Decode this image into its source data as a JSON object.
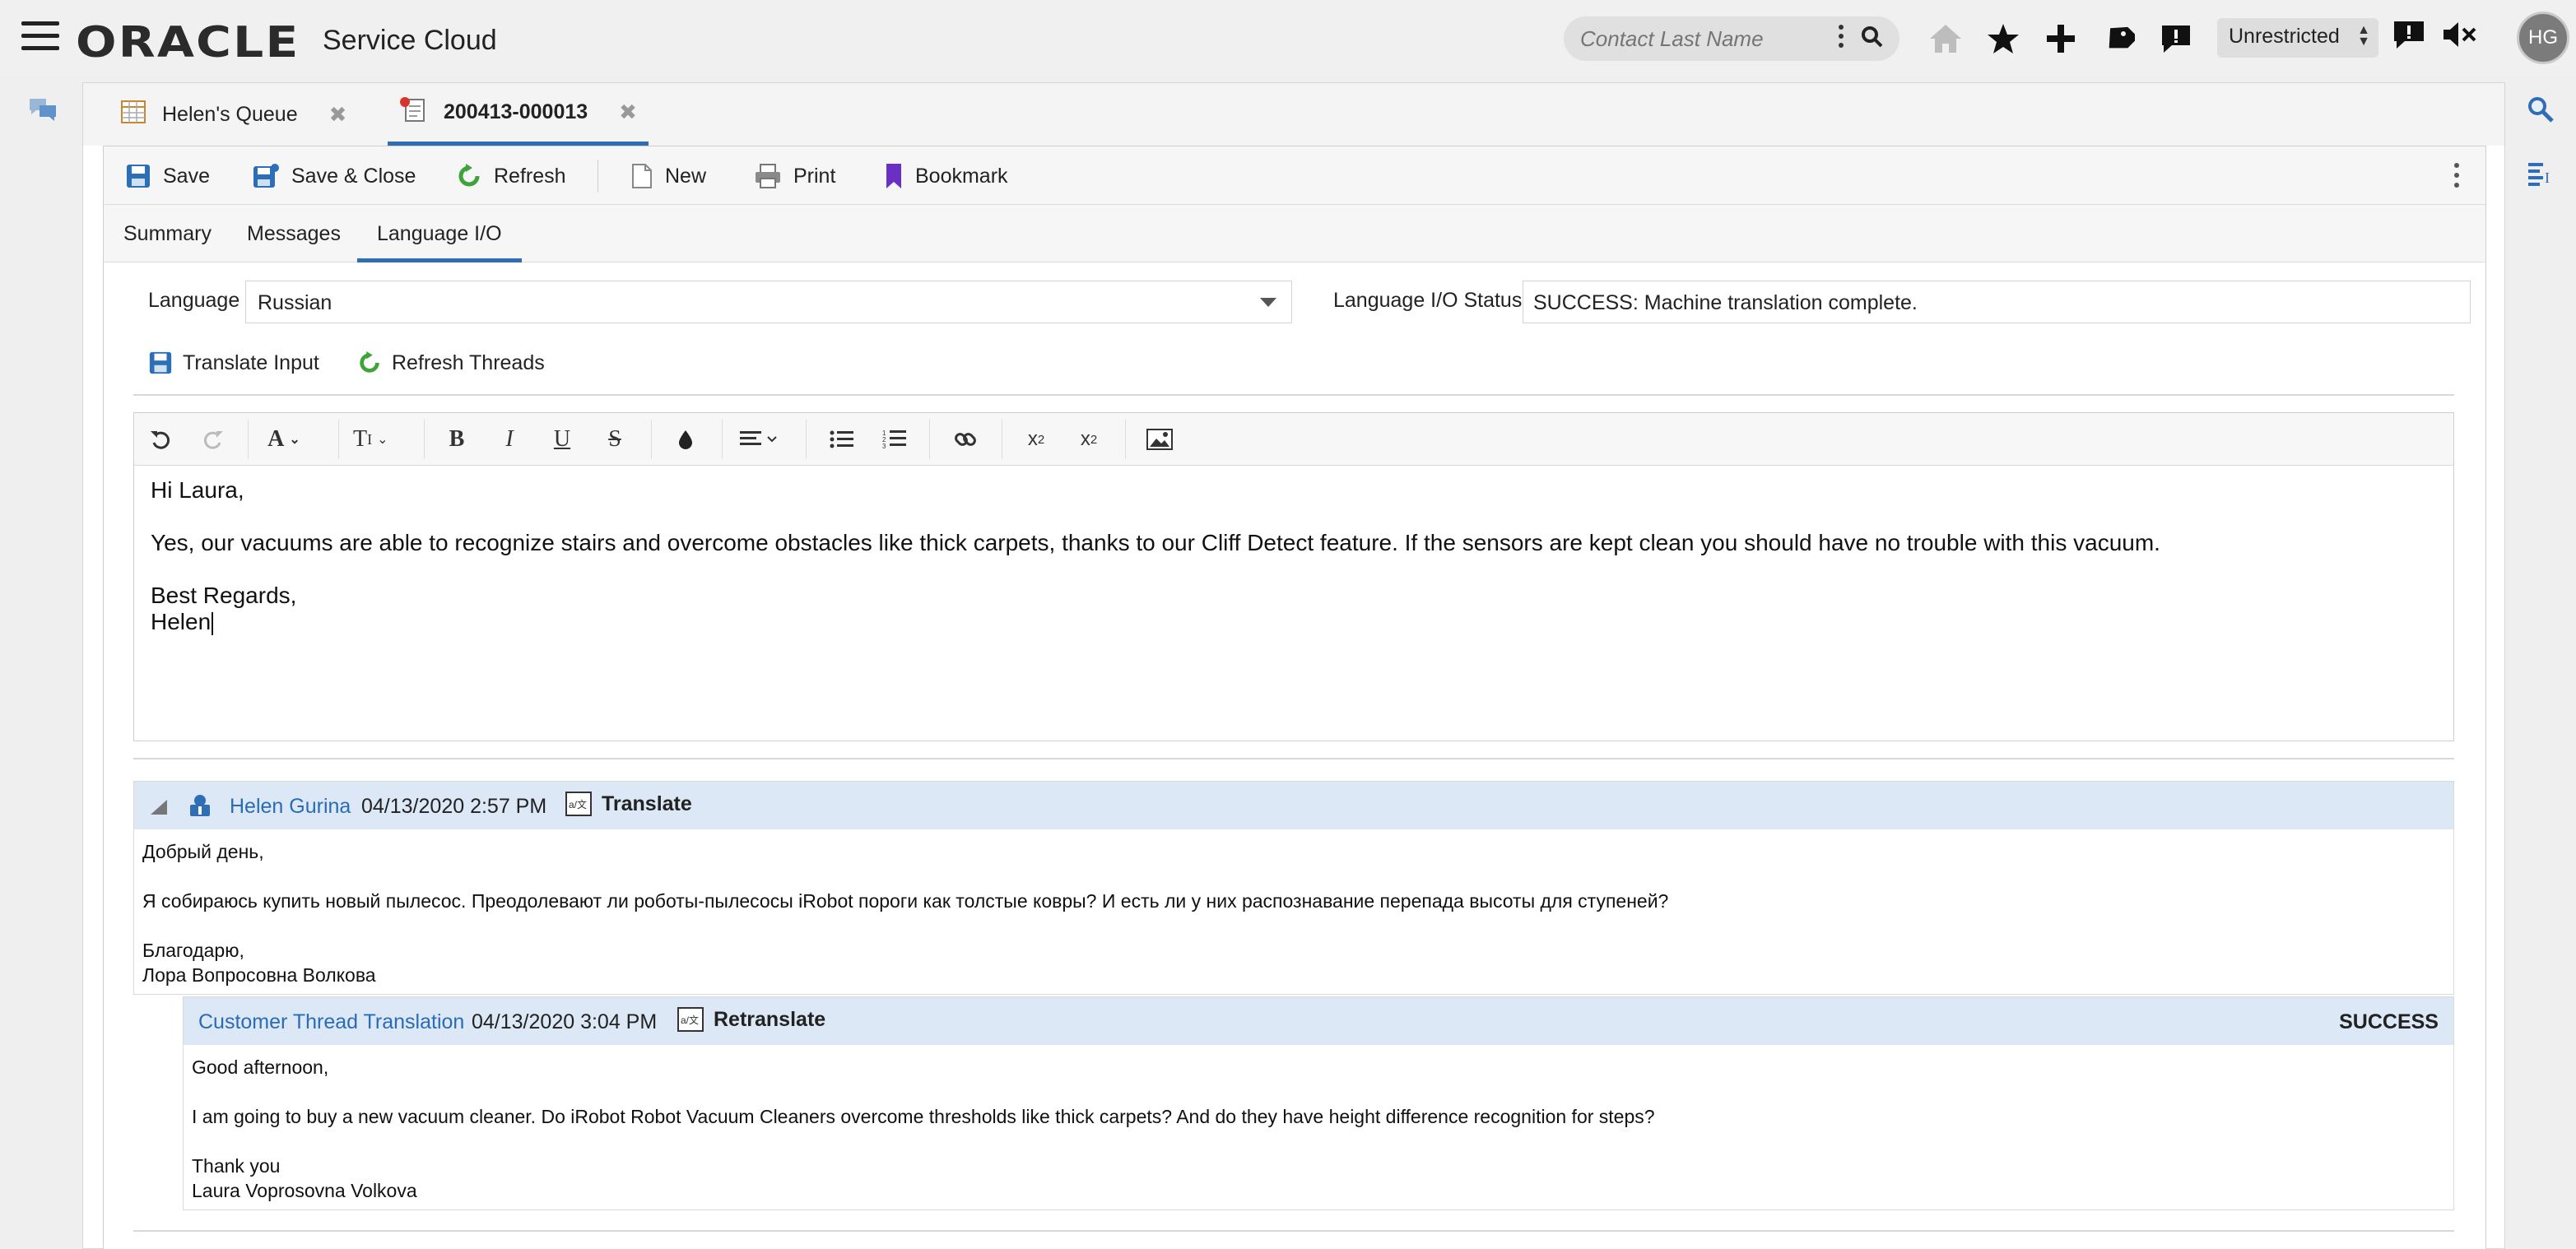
{
  "app": {
    "brand": "ORACLE",
    "product": "Service Cloud"
  },
  "topbar": {
    "search_placeholder": "Contact Last Name",
    "restriction": "Unrestricted",
    "avatar_initials": "HG"
  },
  "tabs": [
    {
      "label": "Helen's Queue"
    },
    {
      "label": "200413-000013"
    }
  ],
  "toolbar": {
    "save": "Save",
    "save_close": "Save & Close",
    "refresh": "Refresh",
    "new": "New",
    "print": "Print",
    "bookmark": "Bookmark"
  },
  "subtabs": [
    {
      "label": "Summary"
    },
    {
      "label": "Messages"
    },
    {
      "label": "Language I/O"
    }
  ],
  "language": {
    "label": "Language",
    "value": "Russian",
    "status_label": "Language I/O Status",
    "status_value": "SUCCESS: Machine translation complete.",
    "translate_input": "Translate Input",
    "refresh_threads": "Refresh Threads"
  },
  "editor": {
    "line1": "Hi Laura,",
    "line2": "Yes, our vacuums are able to recognize stairs and overcome obstacles like thick carpets, thanks to our Cliff Detect feature.  If the sensors are kept clean you should have no trouble with this vacuum.",
    "line3": "Best Regards,",
    "line4": "Helen"
  },
  "thread": {
    "author": "Helen Gurina",
    "timestamp": "04/13/2020 2:57 PM",
    "action": "Translate",
    "body1": "Добрый день,",
    "body2": "Я собираюсь купить новый пылесос. Преодолевают ли роботы-пылесосы iRobot пороги как толстые ковры? И есть ли у них распознавание перепада высоты для ступеней?",
    "body3": "Благодарю,",
    "body4": "Лора Вопросовна Волкова"
  },
  "translation": {
    "title": "Customer Thread Translation",
    "timestamp": "04/13/2020 3:04 PM",
    "action": "Retranslate",
    "status": "SUCCESS",
    "body1": "Good afternoon,",
    "body2": "I am going to buy a new vacuum cleaner. Do iRobot Robot Vacuum Cleaners overcome thresholds like thick carpets? And do they have height difference recognition for steps?",
    "body3": "Thank you",
    "body4": "Laura Voprosovna Volkova"
  },
  "colors": {
    "accent": "#2f6db5",
    "thread_header": "#dce8f6",
    "save_icon": "#2d6fb7",
    "refresh_icon": "#3ea43a",
    "bookmark_icon": "#6a2fc4"
  }
}
